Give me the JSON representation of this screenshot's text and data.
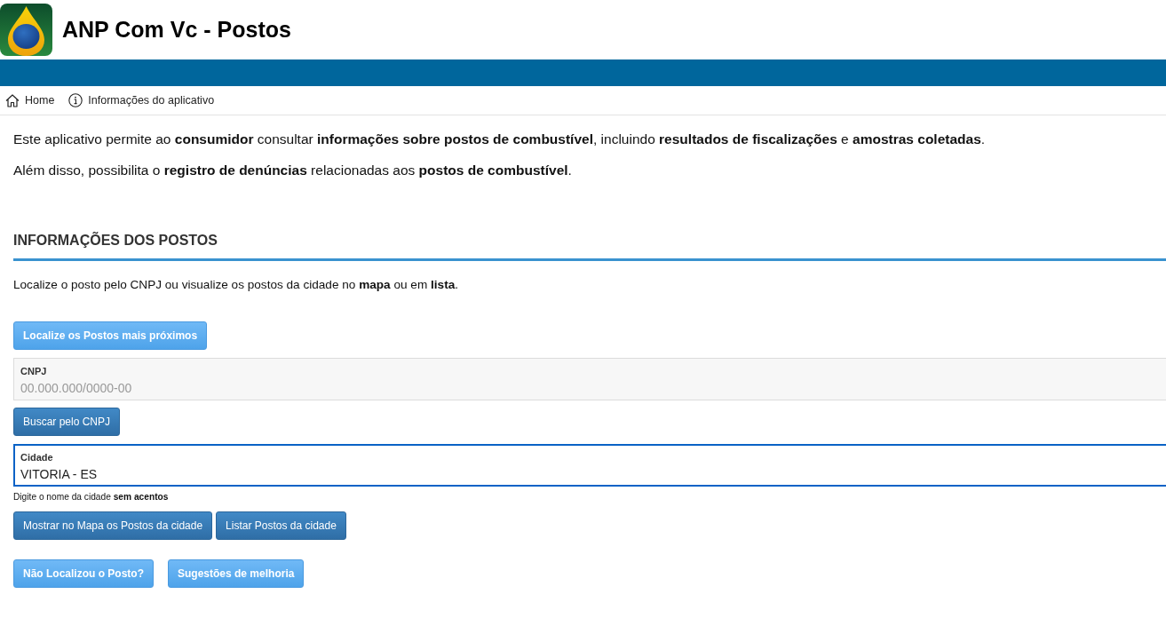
{
  "header": {
    "title": "ANP Com Vc - Postos"
  },
  "nav": [
    {
      "label": "Home"
    },
    {
      "label": "Informações do aplicativo"
    }
  ],
  "intro": [
    "Este aplicativo permite ao **consumidor** consultar **informações sobre postos de combustível**, incluindo **resultados de fiscalizações** e **amostras coletadas**.",
    "Além disso, possibilita o **registro de denúncias** relacionadas aos **postos de combustível**."
  ],
  "section": {
    "heading": "INFORMAÇÕES DOS POSTOS",
    "description": "Localize o posto pelo CNPJ ou visualize os postos da cidade no **mapa** ou em **lista**."
  },
  "nearby_button": {
    "label": "Localize os Postos mais próximos",
    "kind": "light"
  },
  "cnpj_field": {
    "label": "CNPJ",
    "placeholder": "00.000.000/0000-00",
    "focused": false
  },
  "cnpj_button": {
    "label": "Buscar pelo CNPJ",
    "kind": "dark"
  },
  "city_field": {
    "label": "Cidade",
    "value": "VITORIA - ES",
    "focused": true
  },
  "city_hint": "Digite o nome da cidade **sem acentos**",
  "city_buttons": [
    {
      "label": "Mostrar no Mapa os Postos da cidade",
      "kind": "dark"
    },
    {
      "label": "Listar Postos da cidade",
      "kind": "dark"
    }
  ],
  "help_buttons": [
    {
      "label": "Não Localizou o Posto?",
      "kind": "light"
    },
    {
      "label": "Sugestões de melhoria",
      "kind": "light"
    }
  ]
}
